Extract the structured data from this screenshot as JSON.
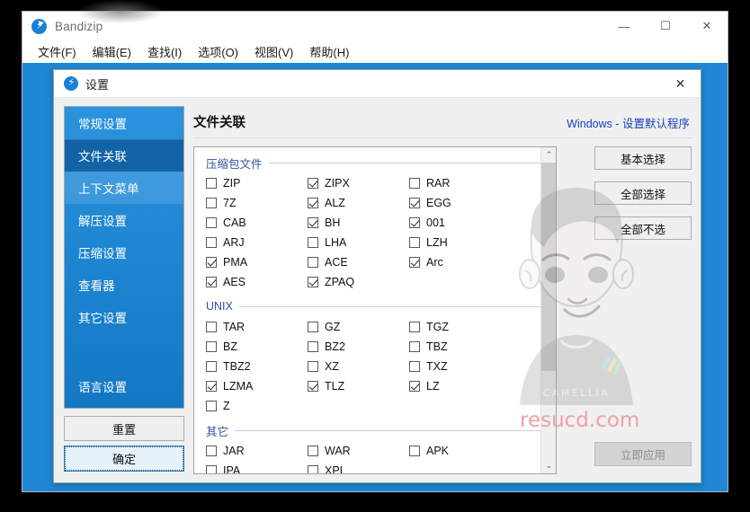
{
  "window": {
    "app_icon": "bandizip-bolt-icon",
    "title": "Bandizip",
    "controls": [
      {
        "name": "minimize-button",
        "glyph": "—"
      },
      {
        "name": "maximize-button",
        "glyph": "☐"
      },
      {
        "name": "close-button",
        "glyph": "✕"
      }
    ],
    "menu": [
      {
        "name": "menu-file",
        "label": "文件(F)"
      },
      {
        "name": "menu-edit",
        "label": "编辑(E)"
      },
      {
        "name": "menu-find",
        "label": "查找(I)"
      },
      {
        "name": "menu-options",
        "label": "选项(O)"
      },
      {
        "name": "menu-view",
        "label": "视图(V)"
      },
      {
        "name": "menu-help",
        "label": "帮助(H)"
      }
    ]
  },
  "dialog": {
    "icon": "bandizip-bolt-icon",
    "title": "设置",
    "close_glyph": "✕",
    "sidebar": {
      "items": [
        {
          "label": "常规设置",
          "state": "normal"
        },
        {
          "label": "文件关联",
          "state": "selected"
        },
        {
          "label": "上下文菜单",
          "state": "hover"
        },
        {
          "label": "解压设置",
          "state": "normal"
        },
        {
          "label": "压缩设置",
          "state": "normal"
        },
        {
          "label": "查看器",
          "state": "normal"
        },
        {
          "label": "其它设置",
          "state": "normal"
        }
      ],
      "language_item": {
        "label": "语言设置"
      }
    },
    "reset_button": "重置",
    "ok_button": "确定",
    "pane": {
      "title": "文件关联",
      "default_programs_link": "Windows - 设置默认程序",
      "groups": [
        {
          "name": "压缩包文件",
          "rows": [
            [
              {
                "label": "ZIP",
                "checked": false
              },
              {
                "label": "ZIPX",
                "checked": true
              },
              {
                "label": "RAR",
                "checked": false
              }
            ],
            [
              {
                "label": "7Z",
                "checked": false
              },
              {
                "label": "ALZ",
                "checked": true
              },
              {
                "label": "EGG",
                "checked": true
              }
            ],
            [
              {
                "label": "CAB",
                "checked": false
              },
              {
                "label": "BH",
                "checked": true
              },
              {
                "label": "001",
                "checked": true
              }
            ],
            [
              {
                "label": "ARJ",
                "checked": false
              },
              {
                "label": "LHA",
                "checked": false
              },
              {
                "label": "LZH",
                "checked": false
              }
            ],
            [
              {
                "label": "PMA",
                "checked": true
              },
              {
                "label": "ACE",
                "checked": false
              },
              {
                "label": "Arc",
                "checked": true
              }
            ],
            [
              {
                "label": "AES",
                "checked": true
              },
              {
                "label": "ZPAQ",
                "checked": true
              }
            ]
          ]
        },
        {
          "name": "UNIX",
          "rows": [
            [
              {
                "label": "TAR",
                "checked": false
              },
              {
                "label": "GZ",
                "checked": false
              },
              {
                "label": "TGZ",
                "checked": false
              }
            ],
            [
              {
                "label": "BZ",
                "checked": false
              },
              {
                "label": "BZ2",
                "checked": false
              },
              {
                "label": "TBZ",
                "checked": false
              }
            ],
            [
              {
                "label": "TBZ2",
                "checked": false
              },
              {
                "label": "XZ",
                "checked": false
              },
              {
                "label": "TXZ",
                "checked": false
              }
            ],
            [
              {
                "label": "LZMA",
                "checked": true
              },
              {
                "label": "TLZ",
                "checked": true
              },
              {
                "label": "LZ",
                "checked": true
              }
            ],
            [
              {
                "label": "Z",
                "checked": false
              }
            ]
          ]
        },
        {
          "name": "其它",
          "rows": [
            [
              {
                "label": "JAR",
                "checked": false
              },
              {
                "label": "WAR",
                "checked": false
              },
              {
                "label": "APK",
                "checked": false
              }
            ],
            [
              {
                "label": "IPA",
                "checked": false
              },
              {
                "label": "XPI",
                "checked": false
              }
            ]
          ]
        }
      ],
      "scrollbar": {
        "up_glyph": "⌃",
        "down_glyph": "⌄"
      },
      "buttons": [
        {
          "name": "basic-select-button",
          "label": "基本选择"
        },
        {
          "name": "select-all-button",
          "label": "全部选择"
        },
        {
          "name": "deselect-all-button",
          "label": "全部不选"
        }
      ],
      "apply_button": {
        "label": "立即应用",
        "disabled": true
      }
    }
  },
  "watermark": {
    "brand": "CAMELLIA",
    "site": "resucd.com",
    "site_color": "#f0a0a4"
  },
  "colors": {
    "accent": "#1e87d6",
    "sidebar_selected": "#1263a5",
    "link": "#1c3fbf",
    "group_label": "#2f4f9e"
  }
}
